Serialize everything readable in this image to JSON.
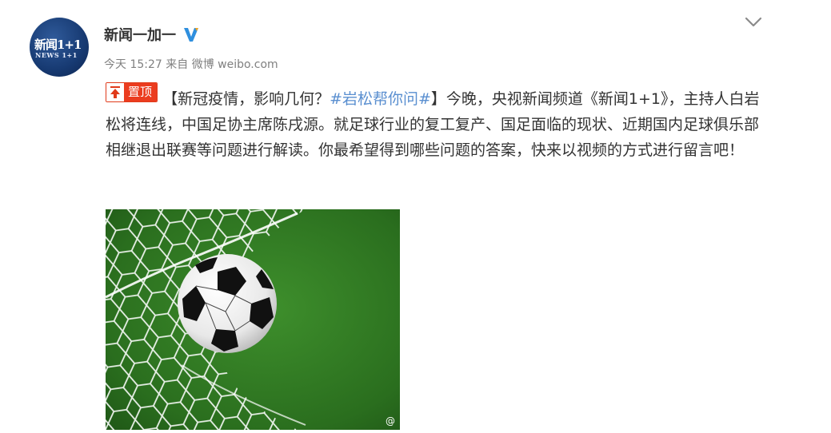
{
  "post": {
    "author": "新闻一加一",
    "avatar_text": "新闻1+1",
    "avatar_subtext": "NEWS 1+1",
    "meta": {
      "time": "今天 15:27",
      "from_label": "来自",
      "source": "微博 weibo.com"
    },
    "pin_label": "置顶",
    "text_before_hashtag": "【新冠疫情，影响几何？",
    "hashtag": "#岩松帮你问#",
    "text_after_hashtag": "】今晚，央视新闻频道《新闻1+1》，主持人白岩松将连线，中国足协主席陈戌源。就足球行业的复工复产、国足面临的现状、近期国内足球俱乐部相继退出联赛等问题进行解读。你最希望得到哪些问题的答案，快来以视频的方式进行留言吧！",
    "image_alt": "soccer ball in goal net",
    "watermark": "@"
  },
  "colors": {
    "hashtag": "#5a8fd0",
    "pin_badge": "#eb3c1f",
    "verified": "#2f8fde",
    "meta_text": "#808080"
  },
  "icons": [
    "verified-badge-icon",
    "chevron-down-icon",
    "pin-arrow-icon",
    "weibo-watermark-icon"
  ]
}
